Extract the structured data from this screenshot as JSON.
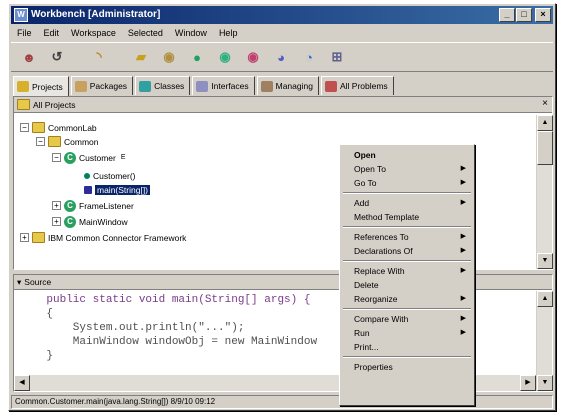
{
  "window": {
    "title": "Workbench [Administrator]",
    "icon_label": "W",
    "buttons": [
      "_",
      "□",
      "×"
    ]
  },
  "menubar": [
    "File",
    "Edit",
    "Workspace",
    "Selected",
    "Window",
    "Help"
  ],
  "toolbar_icons": [
    "person-icon",
    "history-icon",
    "dot-icon",
    "dot-icon",
    "folder-icon",
    "package-icon",
    "class-icon",
    "method-icon",
    "run-icon",
    "debug-icon",
    "browse-icon",
    "help-icon"
  ],
  "tabs": [
    {
      "label": "Projects",
      "active": true,
      "color": "#d8b030"
    },
    {
      "label": "Packages",
      "active": false,
      "color": "#c8a060"
    },
    {
      "label": "Classes",
      "active": false,
      "color": "#30a0a0"
    },
    {
      "label": "Interfaces",
      "active": false,
      "color": "#9090c0"
    },
    {
      "label": "Managing",
      "active": false,
      "color": "#a08060"
    },
    {
      "label": "All Problems",
      "active": false,
      "color": "#c05050"
    }
  ],
  "projects_pane": {
    "title": "All Projects",
    "tree": [
      {
        "label": "CommonLab",
        "icon": "folder",
        "expander": "−"
      },
      {
        "label": "Common",
        "icon": "folder",
        "expander": "−"
      },
      {
        "label": "Customer",
        "icon": "class",
        "expander": "−",
        "suffix": "E"
      },
      {
        "label": "Customer()",
        "icon": "leaf",
        "expander": ""
      },
      {
        "label": "main(String[])",
        "icon": "method",
        "expander": "",
        "selected": true
      },
      {
        "label": "FrameListener",
        "icon": "class",
        "expander": "+"
      },
      {
        "label": "MainWindow",
        "icon": "class",
        "expander": "+"
      },
      {
        "label": "IBM Common Connector Framework",
        "icon": "folder",
        "expander": "+"
      }
    ]
  },
  "source_pane": {
    "title": "Source",
    "lines": [
      "    public static void main(String[] args) {",
      "    {",
      "        System.out.println(\"...\");",
      "        MainWindow windowObj = new MainWindow",
      "    }"
    ]
  },
  "context_menu": {
    "items": [
      {
        "label": "Open",
        "bold": true,
        "arrow": false
      },
      {
        "label": "Open To",
        "arrow": true
      },
      {
        "label": "Go To",
        "arrow": true
      },
      {
        "sep": true
      },
      {
        "label": "Add",
        "arrow": true
      },
      {
        "label": "Method Template",
        "arrow": false
      },
      {
        "sep": true
      },
      {
        "label": "References To",
        "arrow": true
      },
      {
        "label": "Declarations Of",
        "arrow": true
      },
      {
        "sep": true
      },
      {
        "label": "Replace With",
        "arrow": true
      },
      {
        "label": "Delete",
        "arrow": false
      },
      {
        "label": "Reorganize",
        "arrow": true
      },
      {
        "sep": true
      },
      {
        "label": "Compare With",
        "arrow": true
      },
      {
        "label": "Run",
        "arrow": true
      },
      {
        "label": "Print...",
        "arrow": false
      },
      {
        "sep": true
      },
      {
        "label": "Properties",
        "arrow": false
      }
    ]
  },
  "statusbar": {
    "text": "Common.Customer.main(java.lang.String[]) 8/9/10 09:12"
  }
}
